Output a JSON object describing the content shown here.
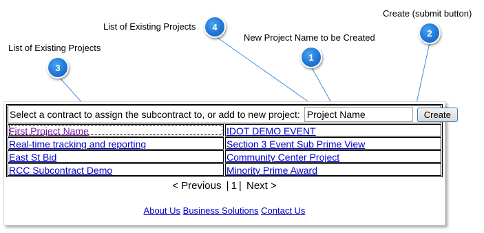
{
  "callouts": [
    {
      "number": "1",
      "label": "New Project Name to be Created"
    },
    {
      "number": "2",
      "label": "Create (submit button)"
    },
    {
      "number": "3",
      "label": "List of Existing Projects"
    },
    {
      "number": "4",
      "label": "List of Existing Projects"
    }
  ],
  "form": {
    "prompt": "Select a contract to assign the subcontract to, or add to new project:",
    "project_name_value": "Project Name",
    "create_label": "Create"
  },
  "projects": {
    "left": [
      "First Project Name",
      "Real-time tracking and reporting",
      "East St Bid",
      "RCC Subcontract Demo"
    ],
    "right": [
      "IDOT DEMO EVENT",
      "Section 3 Event Sub Prime View",
      "Community Center Project",
      "Minority Prime Award"
    ]
  },
  "pager": {
    "previous": "< Previous",
    "separator": "|",
    "page": "1",
    "next": "Next >"
  },
  "footer": {
    "links": [
      "About Us",
      "Business Solutions",
      "Contact Us"
    ]
  },
  "colors": {
    "badge": "#1f78d6",
    "leader_line": "#3d8ee0",
    "link": "#0000cc",
    "visited_link": "#7b1fa2"
  }
}
